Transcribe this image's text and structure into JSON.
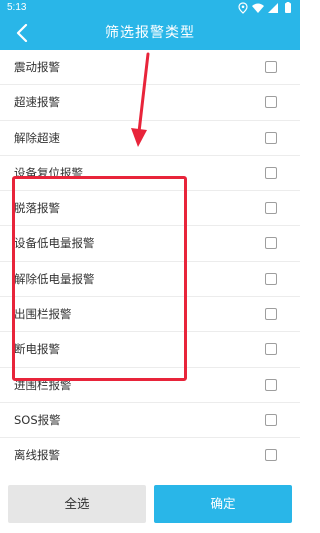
{
  "status_bar": {
    "time": "5:13",
    "icons": [
      "location-icon",
      "wifi-icon",
      "signal-icon",
      "battery-icon"
    ]
  },
  "header": {
    "title": "筛选报警类型",
    "back_icon": "chevron-left-icon"
  },
  "alarm_types": [
    {
      "label": "震动报警",
      "checked": false
    },
    {
      "label": "超速报警",
      "checked": false
    },
    {
      "label": "解除超速",
      "checked": false
    },
    {
      "label": "设备复位报警",
      "checked": false
    },
    {
      "label": "脱落报警",
      "checked": false
    },
    {
      "label": "设备低电量报警",
      "checked": false
    },
    {
      "label": "解除低电量报警",
      "checked": false
    },
    {
      "label": "出围栏报警",
      "checked": false
    },
    {
      "label": "断电报警",
      "checked": false
    },
    {
      "label": "进围栏报警",
      "checked": false
    },
    {
      "label": "SOS报警",
      "checked": false
    },
    {
      "label": "离线报警",
      "checked": false
    }
  ],
  "footer": {
    "select_all_label": "全选",
    "confirm_label": "确定"
  },
  "colors": {
    "accent": "#29b6e8",
    "annotation": "#e8243a",
    "secondary_button": "#e6e6e6"
  }
}
